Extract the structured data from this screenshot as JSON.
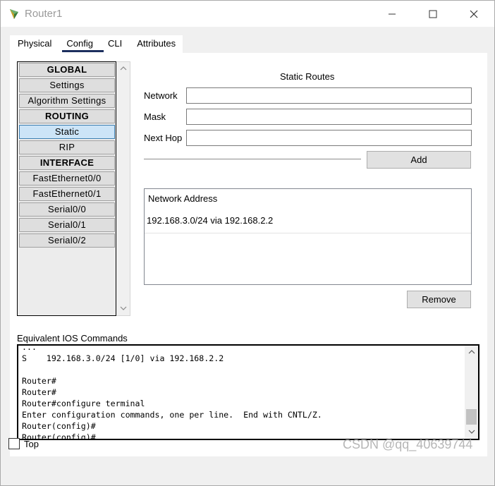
{
  "window": {
    "title": "Router1",
    "icon": "router-app-icon",
    "controls": [
      "minimize-icon",
      "maximize-icon",
      "close-icon"
    ]
  },
  "tabs": [
    {
      "label": "Physical"
    },
    {
      "label": "Config",
      "active": true
    },
    {
      "label": "CLI"
    },
    {
      "label": "Attributes"
    }
  ],
  "nav": {
    "items": [
      {
        "label": "GLOBAL",
        "header": true
      },
      {
        "label": "Settings"
      },
      {
        "label": "Algorithm Settings"
      },
      {
        "label": "ROUTING",
        "header": true
      },
      {
        "label": "Static",
        "selected": true
      },
      {
        "label": "RIP"
      },
      {
        "label": "INTERFACE",
        "header": true
      },
      {
        "label": "FastEthernet0/0"
      },
      {
        "label": "FastEthernet0/1"
      },
      {
        "label": "Serial0/0"
      },
      {
        "label": "Serial0/1"
      },
      {
        "label": "Serial0/2"
      }
    ]
  },
  "static_routes": {
    "title": "Static Routes",
    "network_label": "Network",
    "network_value": "",
    "mask_label": "Mask",
    "mask_value": "",
    "next_hop_label": "Next Hop",
    "next_hop_value": "",
    "add_label": "Add",
    "list_header": "Network Address",
    "routes": [
      "192.168.3.0/24 via 192.168.2.2"
    ],
    "remove_label": "Remove"
  },
  "ios": {
    "label": "Equivalent IOS Commands",
    "lines": [
      "...",
      "S    192.168.3.0/24 [1/0] via 192.168.2.2",
      "",
      "Router#",
      "Router#",
      "Router#configure terminal",
      "Enter configuration commands, one per line.  End with CNTL/Z.",
      "Router(config)#",
      "Router(config)#"
    ]
  },
  "footer": {
    "top_label": "Top",
    "top_checked": false,
    "watermark": "CSDN @qq_40639744"
  },
  "colors": {
    "selected_bg": "#cce4f7",
    "tab_underline": "#1c2f5e"
  }
}
